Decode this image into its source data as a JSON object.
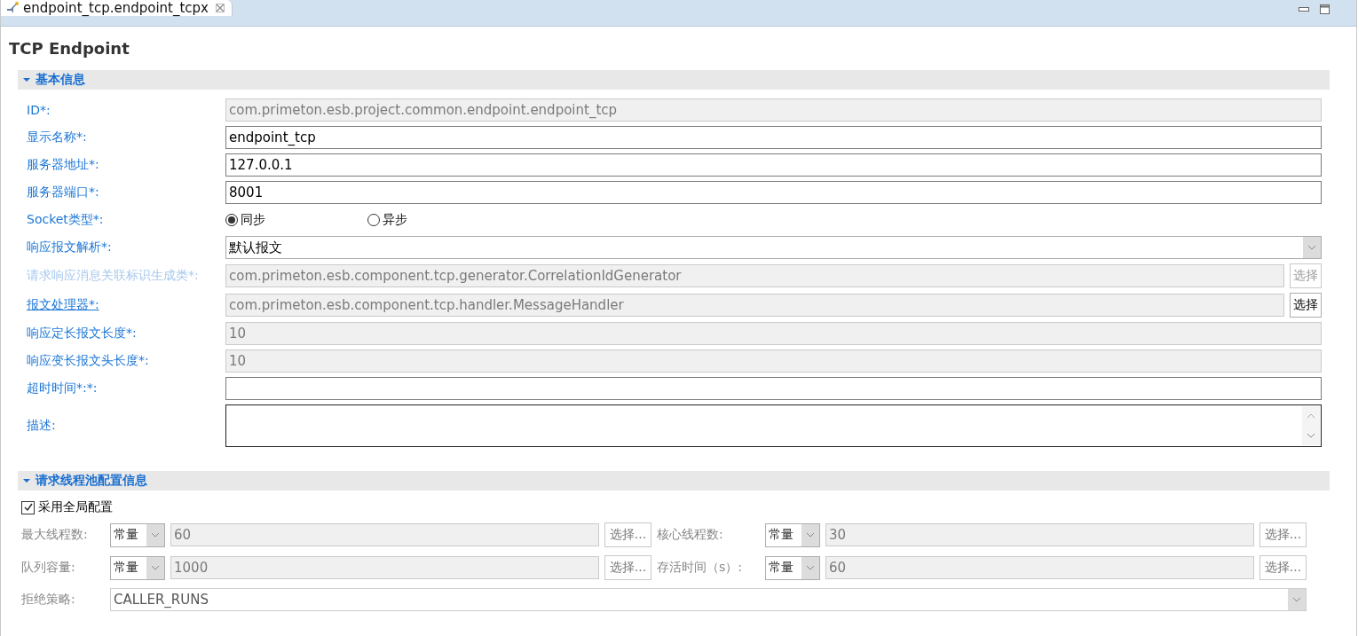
{
  "editor_tab": {
    "title": "endpoint_tcp.endpoint_tcpx",
    "selected": true
  },
  "form_title": "TCP Endpoint",
  "basic_info": {
    "title": "基本信息",
    "expanded": true,
    "fields": [
      {
        "kind": "text",
        "label": "ID*:",
        "label_link": false,
        "label_disabled": false,
        "value": "com.primeton.esb.project.common.endpoint.endpoint_tcp",
        "disabled": true
      },
      {
        "kind": "text",
        "label": "显示名称*:",
        "label_link": false,
        "label_disabled": false,
        "value": "endpoint_tcp",
        "disabled": false
      },
      {
        "kind": "text",
        "label": "服务器地址*:",
        "label_link": false,
        "label_disabled": false,
        "value": "127.0.0.1",
        "disabled": false
      },
      {
        "kind": "text",
        "label": "服务器端口*:",
        "label_link": false,
        "label_disabled": false,
        "value": "8001",
        "disabled": false
      },
      {
        "kind": "radio",
        "label": "Socket类型*:",
        "label_link": false,
        "label_disabled": false,
        "options": [
          {
            "label": "同步",
            "selected": true
          },
          {
            "label": "异步",
            "selected": false
          }
        ]
      },
      {
        "kind": "combo",
        "label": "响应报文解析*:",
        "label_link": false,
        "label_disabled": false,
        "value": "默认报文",
        "disabled": false
      },
      {
        "kind": "text",
        "label": "请求响应消息关联标识生成类*:",
        "label_link": false,
        "label_disabled": true,
        "value": "com.primeton.esb.component.tcp.generator.CorrelationIdGenerator",
        "disabled": true,
        "button": {
          "label": "选择",
          "disabled": true
        }
      },
      {
        "kind": "text",
        "label": "报文处理器*:",
        "label_link": true,
        "label_disabled": false,
        "value": "com.primeton.esb.component.tcp.handler.MessageHandler",
        "disabled": true,
        "button": {
          "label": "选择",
          "disabled": false
        }
      },
      {
        "kind": "text",
        "label": "响应定长报文长度*:",
        "label_link": false,
        "label_disabled": false,
        "value": "10",
        "disabled": true
      },
      {
        "kind": "text",
        "label": "响应变长报文头长度*:",
        "label_link": false,
        "label_disabled": false,
        "value": "10",
        "disabled": true
      },
      {
        "kind": "text",
        "label": "超时时间*:*:",
        "label_link": false,
        "label_disabled": false,
        "disabled": false
      },
      {
        "kind": "textarea",
        "label": "描述:",
        "label_link": false,
        "label_disabled": false,
        "disabled": false
      }
    ]
  },
  "thread_pool": {
    "title": "请求线程池配置信息",
    "expanded": true,
    "use_global": {
      "label": "采用全局配置",
      "checked": true
    },
    "rows": [
      [
        {
          "label": "最大线程数:",
          "mode": "常量",
          "value": "60",
          "button": "选择...",
          "disabled": true
        },
        {
          "label": "核心线程数:",
          "mode": "常量",
          "value": "30",
          "button": "选择...",
          "disabled": true
        }
      ],
      [
        {
          "label": "队列容量:",
          "mode": "常量",
          "value": "1000",
          "button": "选择...",
          "disabled": true
        },
        {
          "label": "存活时间（s）:",
          "mode": "常量",
          "value": "60",
          "button": "选择...",
          "disabled": true
        }
      ]
    ],
    "rejection": {
      "label": "拒绝策略:",
      "value": "CALLER_RUNS",
      "disabled": true
    }
  }
}
